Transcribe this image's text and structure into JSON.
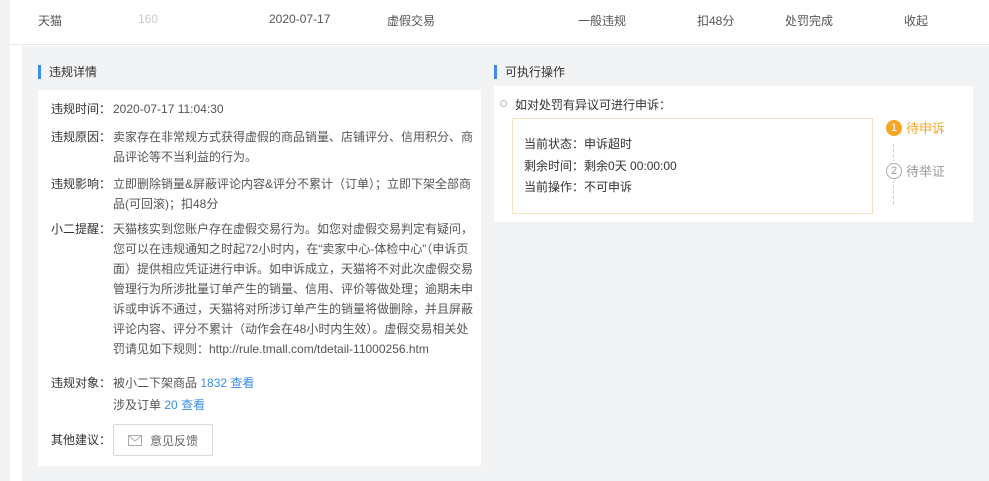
{
  "row": {
    "platform": "天猫",
    "id": "160",
    "date": "2020-07-17",
    "type": "虚假交易",
    "level": "一般违规",
    "penalty": "扣48分",
    "status": "处罚完成",
    "collapse": "收起"
  },
  "detail": {
    "title": "违规详情",
    "time_label": "违规时间：",
    "time": "2020-07-17 11:04:30",
    "reason_label": "违规原因：",
    "reason": "卖家存在非常规方式获得虚假的商品销量、店铺评分、信用积分、商品评论等不当利益的行为。",
    "impact_label": "违规影响：",
    "impact": "立即删除销量&屏蔽评论内容&评分不累计（订单）；立即下架全部商品(可回滚)；扣48分",
    "tip_label": "小二提醒：",
    "tip": "天猫核实到您账户存在虚假交易行为。如您对虚假交易判定有疑问，您可以在违规通知之时起72小时内，在“卖家中心-体检中心”（申诉页面）提供相应凭证进行申诉。如申诉成立，天猫将不对此次虚假交易管理行为所涉批量订单产生的销量、信用、评价等做处理；逾期未申诉或申诉不通过，天猫将对所涉订单产生的销量将做删除，并且屏蔽评论内容、评分不累计（动作会在48小时内生效）。虚假交易相关处罚请见如下规则：http://rule.tmall.com/tdetail-11000256.htm",
    "object_label": "违规对象：",
    "goods_text": "被小二下架商品",
    "goods_count": "1832",
    "view1": "查看",
    "orders_text": "涉及订单",
    "orders_count": "20",
    "view2": "查看",
    "suggest_label": "其他建议：",
    "feedback": "意见反馈"
  },
  "actions": {
    "title": "可执行操作",
    "intro": "如对处罚有异议可进行申诉：",
    "state_label": "当前状态：",
    "state": "申诉超时",
    "remain_label": "剩余时间：",
    "remain": "剩余0天 00:00:00",
    "op_label": "当前操作：",
    "op": "不可申诉",
    "steps": [
      {
        "num": "1",
        "label": "待申诉"
      },
      {
        "num": "2",
        "label": "待举证"
      }
    ]
  },
  "colors": {
    "accent": "#3a8ee6",
    "orange": "#f5a623"
  }
}
